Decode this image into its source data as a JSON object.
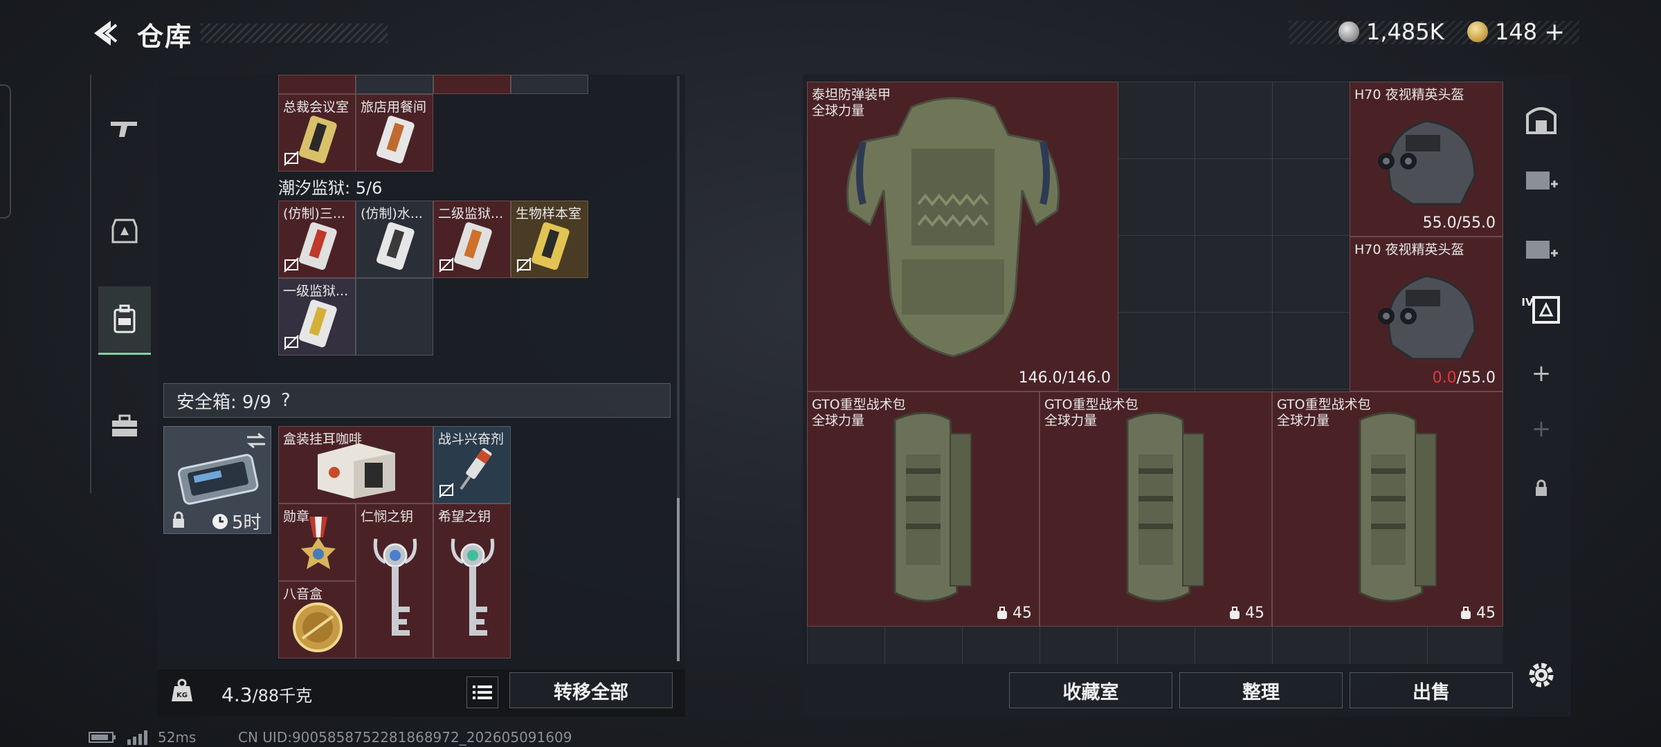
{
  "header": {
    "title": "仓库",
    "currency_silver": "1,485K",
    "currency_gold": "148",
    "plus": "+"
  },
  "left": {
    "top_row_items": [
      {
        "name": "总裁会议室",
        "color": "red"
      },
      {
        "name": "旅店用餐间",
        "color": "red"
      }
    ],
    "section_label": "潮汐监狱: 5/6",
    "prison_items": [
      {
        "name": "(仿制)三...",
        "color": "red"
      },
      {
        "name": "(仿制)水...",
        "color": "dark"
      },
      {
        "name": "二级监狱...",
        "color": "red"
      },
      {
        "name": "生物样本室",
        "color": "gold"
      },
      {
        "name": "一级监狱...",
        "color": "purple"
      }
    ],
    "safebox_label": "安全箱: 9/9",
    "safebox_help": "?",
    "safebox_timer": "5时",
    "safebox_items": [
      {
        "name": "盒装挂耳咖啡",
        "color": "red"
      },
      {
        "name": "战斗兴奋剂",
        "color": "blue"
      },
      {
        "name": "勋章",
        "color": "red"
      },
      {
        "name": "仁悯之钥",
        "color": "red"
      },
      {
        "name": "希望之钥",
        "color": "red"
      },
      {
        "name": "八音盒",
        "color": "red"
      }
    ],
    "weight": "4.3",
    "weight_max": "/88千克",
    "transfer_all": "转移全部"
  },
  "right": {
    "armor": {
      "name": "泰坦防弹装甲",
      "sub": "全球力量",
      "dura": "146.0/146.0"
    },
    "helmet1": {
      "name": "H70 夜视精英头盔",
      "dura": "55.0/55.0"
    },
    "helmet2": {
      "name": "H70 夜视精英头盔",
      "dura_current": "0.0",
      "dura_max": "/55.0"
    },
    "bags": [
      {
        "name": "GTO重型战术包",
        "sub": "全球力量",
        "count": "45"
      },
      {
        "name": "GTO重型战术包",
        "sub": "全球力量",
        "count": "45"
      },
      {
        "name": "GTO重型战术包",
        "sub": "全球力量",
        "count": "45"
      }
    ],
    "buttons": {
      "collection": "收藏室",
      "sort": "整理",
      "sell": "出售"
    }
  },
  "side_tools": {
    "tier_label": "IV",
    "add1": "+",
    "add2": "+"
  },
  "status": {
    "ping": "52ms",
    "uid": "CN UID:9005858752281868972_202605091609"
  },
  "colors": {
    "accent_green": "#7fd1a6",
    "cell_red": "#4a2226",
    "durability_red": "#e2393c"
  }
}
